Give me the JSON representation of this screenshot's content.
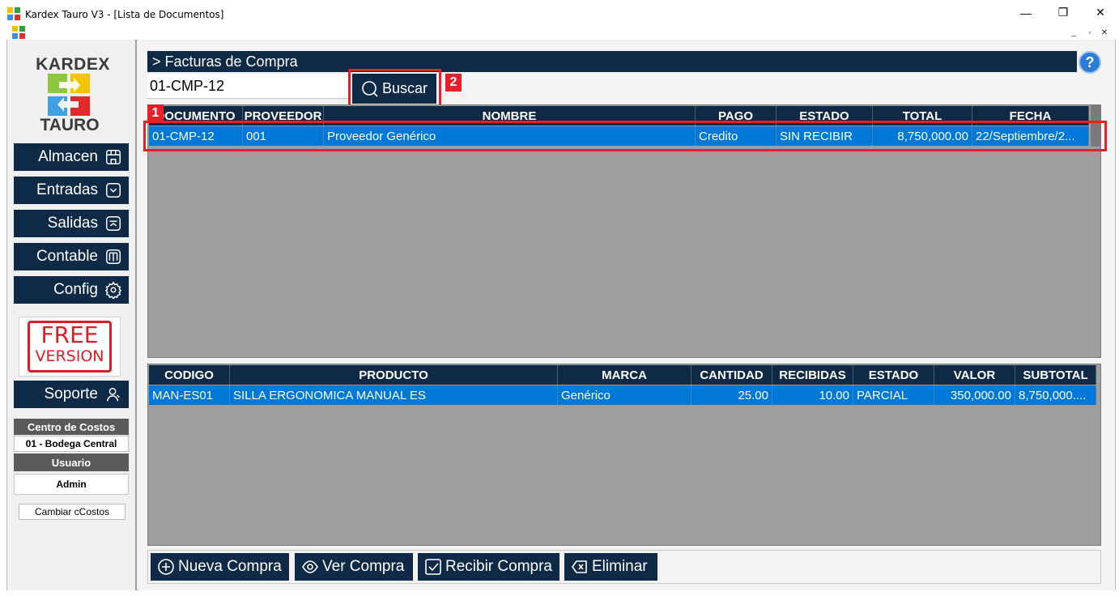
{
  "window": {
    "title": "Kardex Tauro V3 - [Lista de Documentos]",
    "minimize": "—",
    "maximize": "❐",
    "close": "✕"
  },
  "mdi": {
    "minimize": "_",
    "restore": "🗗",
    "close": "✕"
  },
  "logo": {
    "top": "KARDEX",
    "bottom": "TAURO"
  },
  "nav": [
    {
      "label": "Almacen",
      "icon": "store-icon"
    },
    {
      "label": "Entradas",
      "icon": "inbox-down-icon"
    },
    {
      "label": "Salidas",
      "icon": "inbox-up-icon"
    },
    {
      "label": "Contable",
      "icon": "book-icon"
    },
    {
      "label": "Config",
      "icon": "gear-icon"
    }
  ],
  "free_badge": {
    "line1": "FREE",
    "line2": "VERSION"
  },
  "soporte": {
    "label": "Soporte",
    "icon": "support-person-icon"
  },
  "centro": {
    "label": "Centro de Costos",
    "value": "01 - Bodega Central"
  },
  "usuario": {
    "label": "Usuario",
    "value": "Admin"
  },
  "cambiar_label": "Cambiar cCostos",
  "section_title": "> Facturas de Compra",
  "help_label": "?",
  "search": {
    "value": "01-CMP-12",
    "button": "Buscar"
  },
  "annotations": {
    "one": "1",
    "two": "2"
  },
  "top_grid": {
    "headers": [
      "DOCUMENTO",
      "PROVEEDOR",
      "NOMBRE",
      "PAGO",
      "ESTADO",
      "TOTAL",
      "FECHA"
    ],
    "rows": [
      [
        "01-CMP-12",
        "001",
        "Proveedor Genérico",
        "Credito",
        "SIN RECIBIR",
        "8,750,000.00",
        "22/Septiembre/2..."
      ]
    ]
  },
  "bottom_grid": {
    "headers": [
      "CODIGO",
      "PRODUCTO",
      "MARCA",
      "CANTIDAD",
      "RECIBIDAS",
      "ESTADO",
      "VALOR",
      "SUBTOTAL"
    ],
    "rows": [
      [
        "MAN-ES01",
        "SILLA ERGONOMICA MANUAL ES",
        "Genérico",
        "25.00",
        "10.00",
        "PARCIAL",
        "350,000.00",
        "8,750,000...."
      ]
    ]
  },
  "actions": {
    "nueva": "Nueva Compra",
    "ver": "Ver Compra",
    "recibir": "Recibir Compra",
    "eliminar": "Eliminar"
  },
  "colors": {
    "navy": "#0e2a47",
    "selected_row": "#0078d7",
    "annotation_red": "#e5202a",
    "grid_bg": "#9e9e9e"
  }
}
